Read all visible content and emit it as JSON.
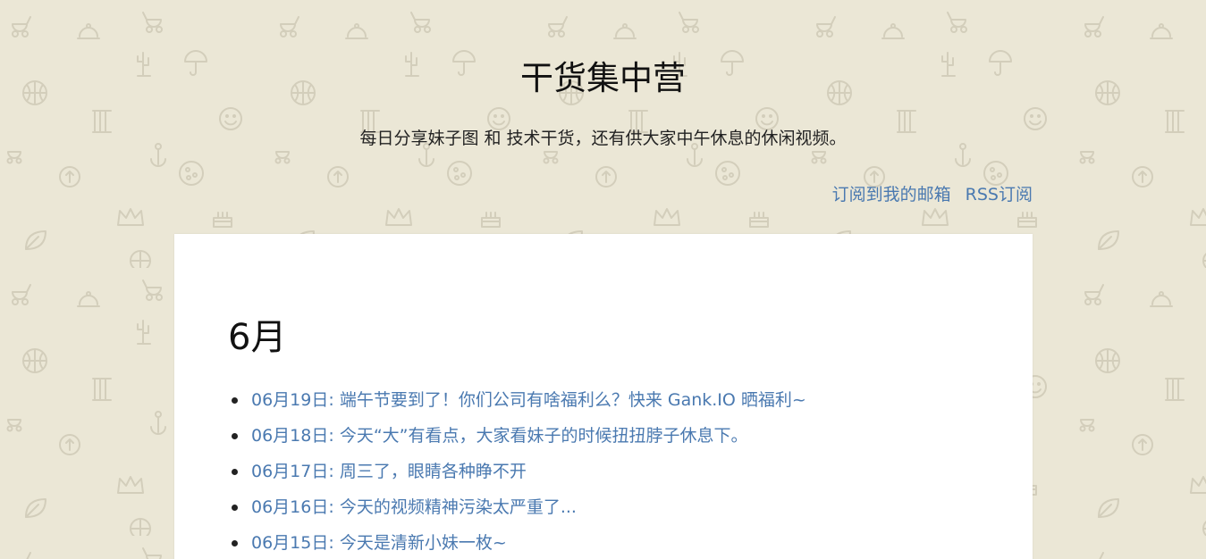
{
  "header": {
    "title": "干货集中营",
    "description": "每日分享妹子图 和 技术干货，还有供大家中午休息的休闲视频。",
    "links": [
      {
        "label": "订阅到我的邮箱"
      },
      {
        "label": "RSS订阅"
      }
    ]
  },
  "main": {
    "month": "6月",
    "posts": [
      {
        "date": "06月19日:",
        "title": "端午节要到了！你们公司有啥福利么？快来 Gank.IO 晒福利~"
      },
      {
        "date": "06月18日:",
        "title": "今天“大”有看点，大家看妹子的时候扭扭脖子休息下。"
      },
      {
        "date": "06月17日:",
        "title": "周三了，眼睛各种睁不开"
      },
      {
        "date": "06月16日:",
        "title": "今天的视频精神污染太严重了..."
      },
      {
        "date": "06月15日:",
        "title": "今天是清新小妹一枚~"
      }
    ]
  },
  "colors": {
    "background": "#ebe7d6",
    "link": "#4a79b0",
    "card": "#ffffff",
    "pattern_icon": "#d5d0bd"
  },
  "icons": [
    "stroller-icon",
    "cloche-icon",
    "cactus-icon",
    "umbrella-icon",
    "basketball-icon",
    "smiley-icon",
    "column-icon",
    "anchor-icon",
    "leaf-icon",
    "crown-icon",
    "pizza-icon",
    "cake-icon"
  ]
}
